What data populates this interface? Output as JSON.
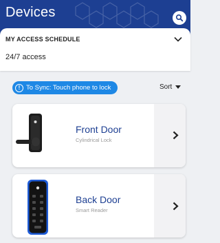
{
  "header": {
    "title": "Devices"
  },
  "schedule": {
    "label": "MY ACCESS SCHEDULE",
    "value": "24/7 access"
  },
  "sync": {
    "info_glyph": "!",
    "label": "To Sync: Touch phone to lock"
  },
  "sort": {
    "label": "Sort"
  },
  "locks": [
    {
      "name": "Front Door",
      "type": "Cylindrical Lock"
    },
    {
      "name": "Back Door",
      "type": "Smart Reader"
    }
  ],
  "colors": {
    "header": "#1d3f92",
    "accent": "#1e88e5",
    "lock_name": "#1d3f92"
  }
}
